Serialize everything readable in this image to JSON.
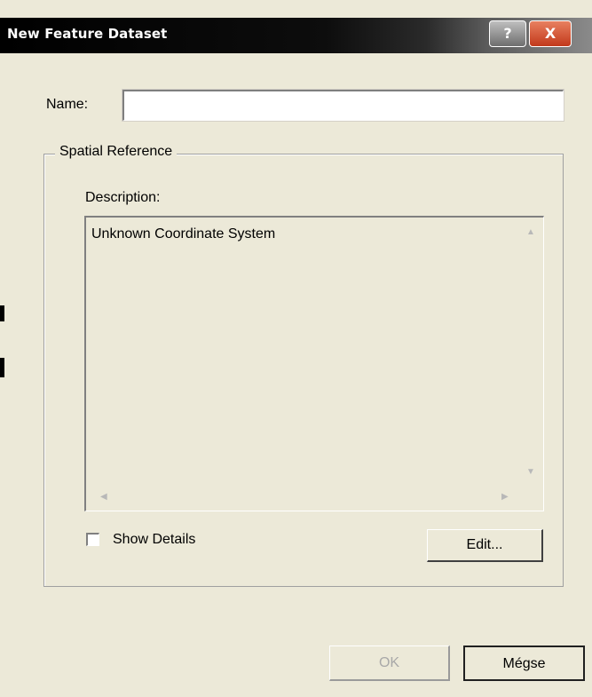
{
  "window": {
    "title": "New Feature Dataset",
    "help_label": "?",
    "close_label": "X"
  },
  "form": {
    "name_label": "Name:",
    "name_value": "",
    "spatial_reference": {
      "group_label": "Spatial Reference",
      "description_label": "Description:",
      "description_text": "Unknown Coordinate System",
      "show_details_label": "Show Details",
      "show_details_checked": false,
      "edit_label": "Edit..."
    }
  },
  "footer": {
    "ok_label": "OK",
    "ok_enabled": false,
    "cancel_label": "Mégse"
  },
  "icons": {
    "scroll_up": "scroll-up-arrow-icon",
    "scroll_down": "scroll-down-arrow-icon",
    "scroll_left": "scroll-left-arrow-icon",
    "scroll_right": "scroll-right-arrow-icon"
  }
}
